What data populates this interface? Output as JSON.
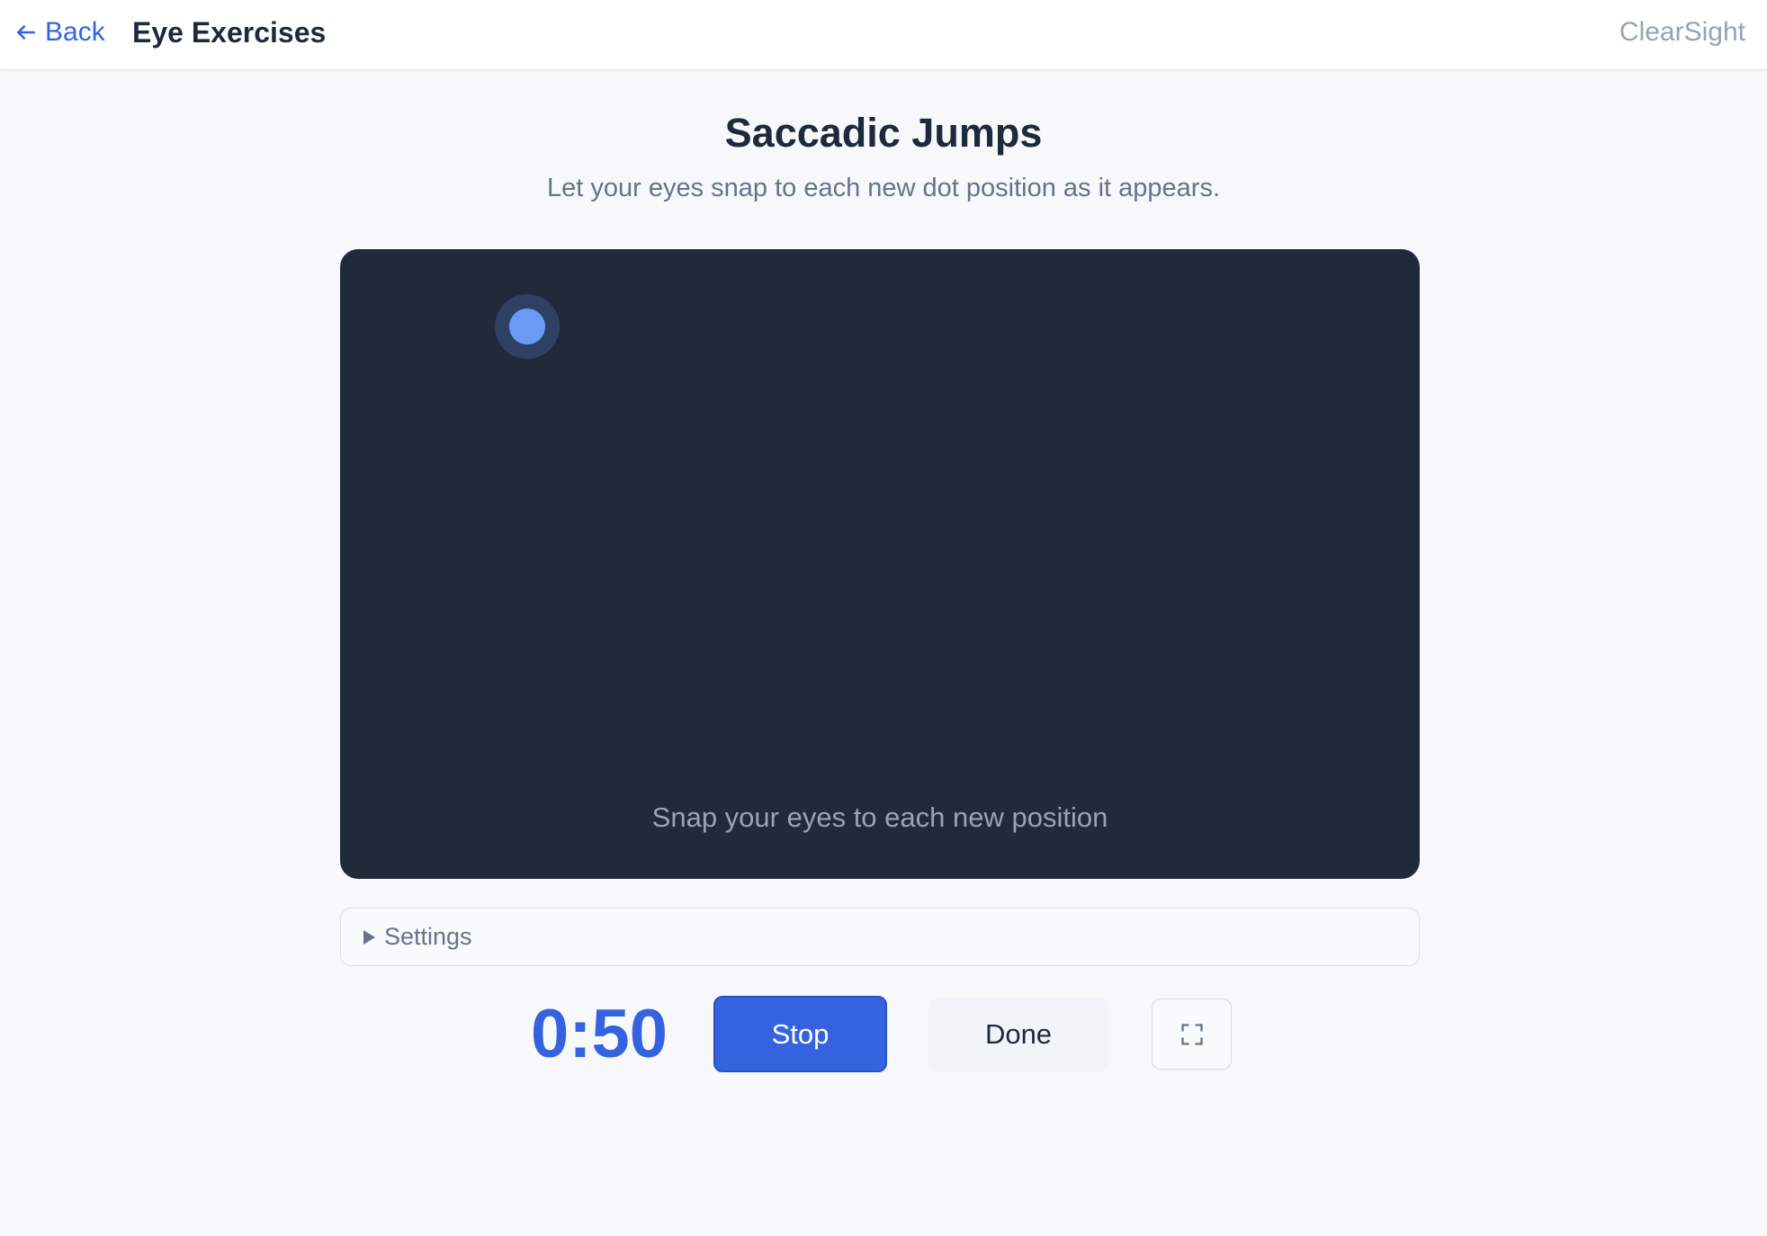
{
  "header": {
    "back_label": "Back",
    "title": "Eye Exercises",
    "brand": "ClearSight"
  },
  "exercise": {
    "title": "Saccadic Jumps",
    "subtitle": "Let your eyes snap to each new dot position as it appears.",
    "stage_hint": "Snap your eyes to each new position"
  },
  "settings": {
    "label": "Settings",
    "expanded": false
  },
  "controls": {
    "timer": "0:50",
    "stop_label": "Stop",
    "done_label": "Done"
  },
  "icons": {
    "back": "arrow-left-icon",
    "fullscreen": "fullscreen-icon",
    "settings_toggle": "triangle-right-icon"
  },
  "colors": {
    "accent": "#3563e0",
    "stage_bg": "#212a3b",
    "dot": "#6a9bf4"
  }
}
